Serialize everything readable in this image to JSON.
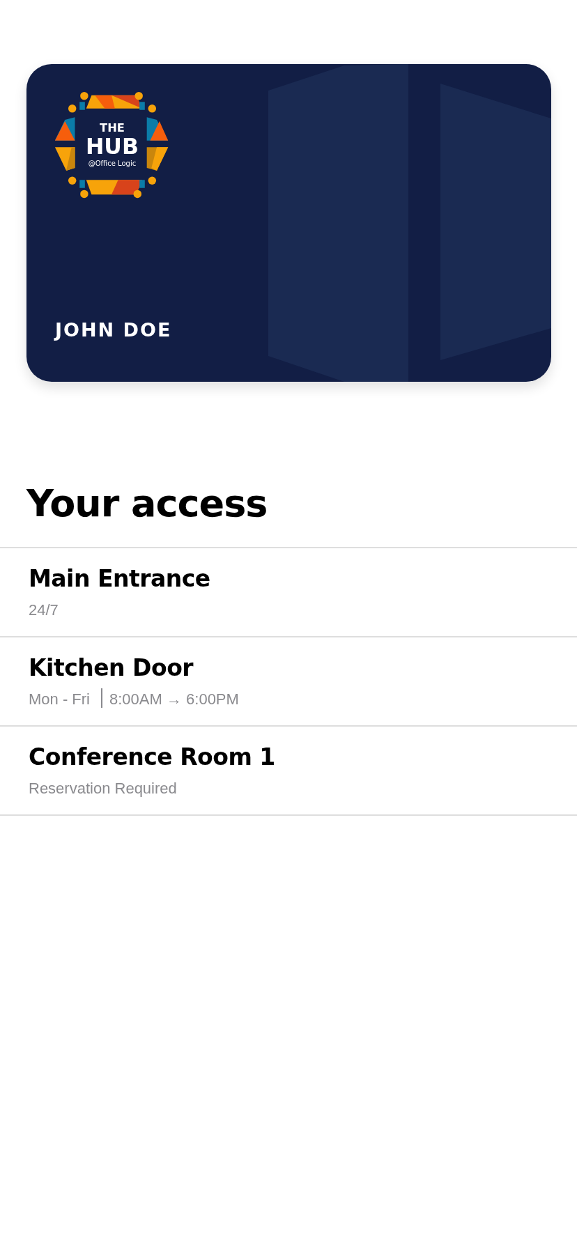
{
  "card": {
    "logo": {
      "line_1": "THE",
      "line_2": "HUB",
      "line_3": "@Office Logic"
    },
    "holder": "JOHN DOE"
  },
  "heading": "Your access",
  "access_items": [
    {
      "name": "Main Entrance",
      "details": [
        "24/7"
      ]
    },
    {
      "name": "Kitchen Door",
      "details": [
        "Mon - Fri",
        "8:00AM → 6:00PM"
      ]
    },
    {
      "name": "Conference Room 1",
      "details": [
        "Reservation Required"
      ]
    }
  ]
}
